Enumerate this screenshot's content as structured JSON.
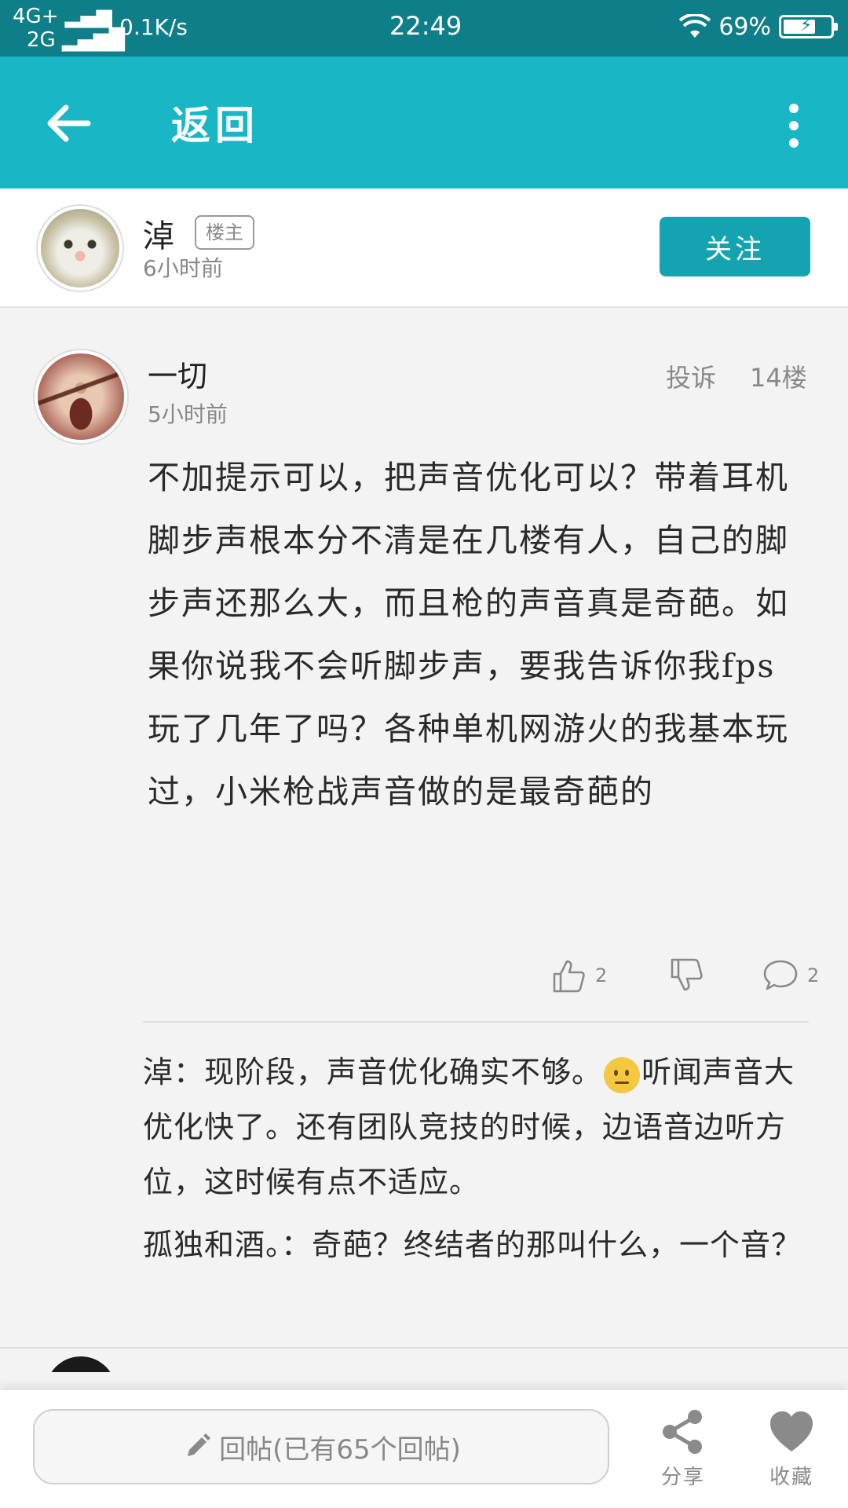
{
  "status_bar": {
    "network_top": "4G+",
    "network_bottom": "2G",
    "speed": "0.1K/s",
    "time": "22:49",
    "battery": "69%",
    "battery_level": 0.69
  },
  "app_bar": {
    "back_icon": "arrow-left-icon",
    "title": "返回",
    "more_icon": "more-vertical-icon"
  },
  "op": {
    "name": "淖",
    "badge": "楼主",
    "time": "6小时前",
    "follow_label": "关注"
  },
  "post": {
    "author": "一切",
    "time": "5小时前",
    "report_label": "投诉",
    "floor": "14楼",
    "body": "不加提示可以，把声音优化可以？带着耳机脚步声根本分不清是在几楼有人，自己的脚步声还那么大，而且枪的声音真是奇葩。如果你说我不会听脚步声，要我告诉你我fps玩了几年了吗？各种单机网游火的我基本玩过，小米枪战声音做的是最奇葩的",
    "likes": "2",
    "comments": "2",
    "replies": [
      {
        "author": "淖",
        "sep": "：",
        "text_before_emoji": "现阶段，声音优化确实不够。",
        "emoji": "sweat-smile-emoji",
        "text_after_emoji": "听闻声音大优化快了。还有团队竞技的时候，边语音边听方位，这时候有点不适应。"
      },
      {
        "author": "孤独和酒。",
        "sep": "：",
        "text": "奇葩？终结者的那叫什么，一个音？"
      }
    ]
  },
  "bottom_bar": {
    "reply_placeholder": "回帖(已有65个回帖)",
    "share_label": "分享",
    "favorite_label": "收藏"
  }
}
